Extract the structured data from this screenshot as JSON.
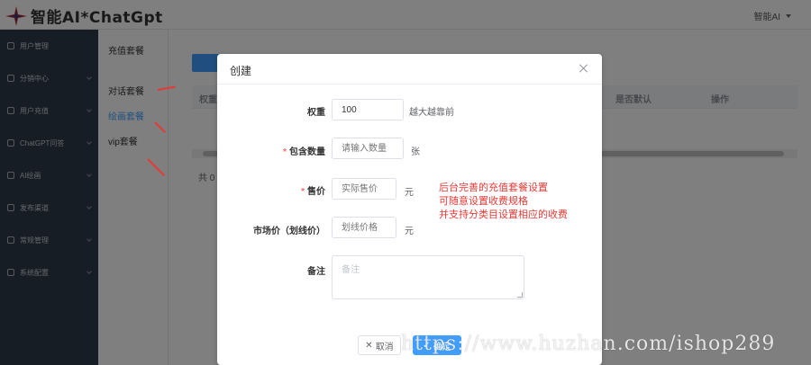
{
  "app": {
    "title": "智能AI*ChatGpt",
    "user": "智能AI"
  },
  "sidebar": {
    "items": [
      {
        "label": "用户管理",
        "has_arrow": false
      },
      {
        "label": "分销中心",
        "has_arrow": true
      },
      {
        "label": "用户充值",
        "has_arrow": true
      },
      {
        "label": "ChatGPT问答",
        "has_arrow": true
      },
      {
        "label": "AI绘画",
        "has_arrow": true
      },
      {
        "label": "发布渠道",
        "has_arrow": true
      },
      {
        "label": "常规管理",
        "has_arrow": true
      },
      {
        "label": "系统配置",
        "has_arrow": true
      }
    ]
  },
  "subnav": {
    "title": "充值套餐",
    "items": [
      {
        "label": "对话套餐",
        "active": false
      },
      {
        "label": "绘画套餐",
        "active": true
      },
      {
        "label": "vip套餐",
        "active": false
      }
    ]
  },
  "table": {
    "columns": [
      "权重",
      "是否默认",
      "操作"
    ],
    "total": "共 0"
  },
  "dialog": {
    "title": "创建",
    "fields": {
      "weight": {
        "label": "权重",
        "value": "100",
        "suffix": "越大越靠前",
        "required": false
      },
      "count": {
        "label": "包含数量",
        "placeholder": "请输入数量",
        "suffix": "张",
        "required": true
      },
      "price": {
        "label": "售价",
        "placeholder": "实际售价",
        "suffix": "元",
        "required": true
      },
      "market_price": {
        "label": "市场价（划线价）",
        "placeholder": "划线价格",
        "suffix": "元",
        "required": false
      },
      "remark": {
        "label": "备注",
        "placeholder": "备注",
        "required": false
      }
    },
    "cancel_label": "取消",
    "ok_label": "确定"
  },
  "annotation": {
    "lines": [
      "后台完善的充值套餐设置",
      "可随意设置收费规格",
      "并支持分类目设置相应的收费"
    ],
    "color": "#e53935"
  },
  "watermark": "https://www.huzhan.com/ishop289",
  "colors": {
    "primary": "#409eff",
    "sidebar": "#2e3a4a",
    "required": "#f56c6c"
  }
}
